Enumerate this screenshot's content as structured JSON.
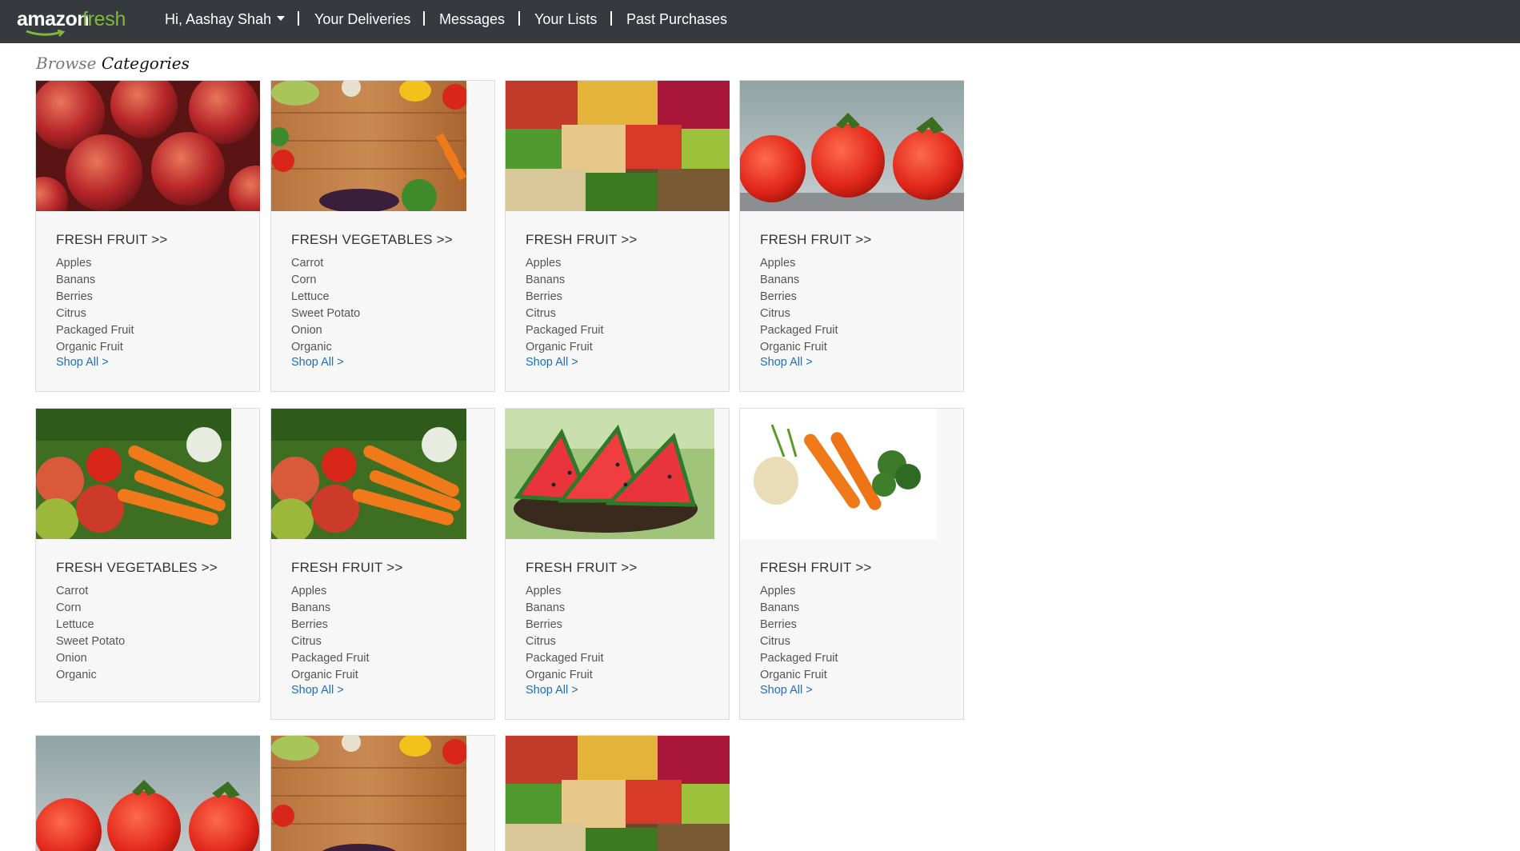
{
  "header": {
    "logo_amazon": "amazon",
    "logo_fresh": "fresh",
    "greeting": "Hi, Aashay Shah",
    "nav": [
      "Your Deliveries",
      "Messages",
      "Your Lists",
      "Past Purchases"
    ]
  },
  "browse": {
    "label_a": "Browse",
    "label_b": "Categories"
  },
  "cards": [
    {
      "title": "FRESH FRUIT >>",
      "items": [
        "Apples",
        "Banans",
        "Berries",
        "Citrus",
        "Packaged Fruit",
        "Organic Fruit"
      ],
      "shop_all": "Shop All >",
      "image": "apples-photo"
    },
    {
      "title": "FRESH VEGETABLES >>",
      "items": [
        "Carrot",
        "Corn",
        "Lettuce",
        "Sweet Potato",
        "Onion",
        "Organic"
      ],
      "shop_all": "Shop All >",
      "image": "vegetables-on-wood-photo"
    },
    {
      "title": "FRESH FRUIT >>",
      "items": [
        "Apples",
        "Banans",
        "Berries",
        "Citrus",
        "Packaged Fruit",
        "Organic Fruit"
      ],
      "shop_all": "Shop All >",
      "image": "produce-market-photo"
    },
    {
      "title": "FRESH FRUIT >>",
      "items": [
        "Apples",
        "Banans",
        "Berries",
        "Citrus",
        "Packaged Fruit",
        "Organic Fruit"
      ],
      "shop_all": "Shop All >",
      "image": "tomatoes-photo"
    },
    {
      "title": "FRESH VEGETABLES >>",
      "items": [
        "Carrot",
        "Corn",
        "Lettuce",
        "Sweet Potato",
        "Onion",
        "Organic"
      ],
      "shop_all": "",
      "image": "carrots-apples-photo"
    },
    {
      "title": "FRESH FRUIT >>",
      "items": [
        "Apples",
        "Banans",
        "Berries",
        "Citrus",
        "Packaged Fruit",
        "Organic Fruit"
      ],
      "shop_all": "Shop All >",
      "image": "carrots-apples-photo"
    },
    {
      "title": "FRESH FRUIT >>",
      "items": [
        "Apples",
        "Banans",
        "Berries",
        "Citrus",
        "Packaged Fruit",
        "Organic Fruit"
      ],
      "shop_all": "Shop All >",
      "image": "watermelon-photo"
    },
    {
      "title": "FRESH FRUIT >>",
      "items": [
        "Apples",
        "Banans",
        "Berries",
        "Citrus",
        "Packaged Fruit",
        "Organic Fruit"
      ],
      "shop_all": "Shop All >",
      "image": "carrots-potato-broccoli-photo"
    },
    {
      "title": "",
      "items": [],
      "shop_all": "",
      "image": "tomatoes-photo"
    },
    {
      "title": "",
      "items": [],
      "shop_all": "",
      "image": "vegetables-on-wood-photo"
    },
    {
      "title": "",
      "items": [],
      "shop_all": "",
      "image": "produce-market-photo"
    }
  ]
}
